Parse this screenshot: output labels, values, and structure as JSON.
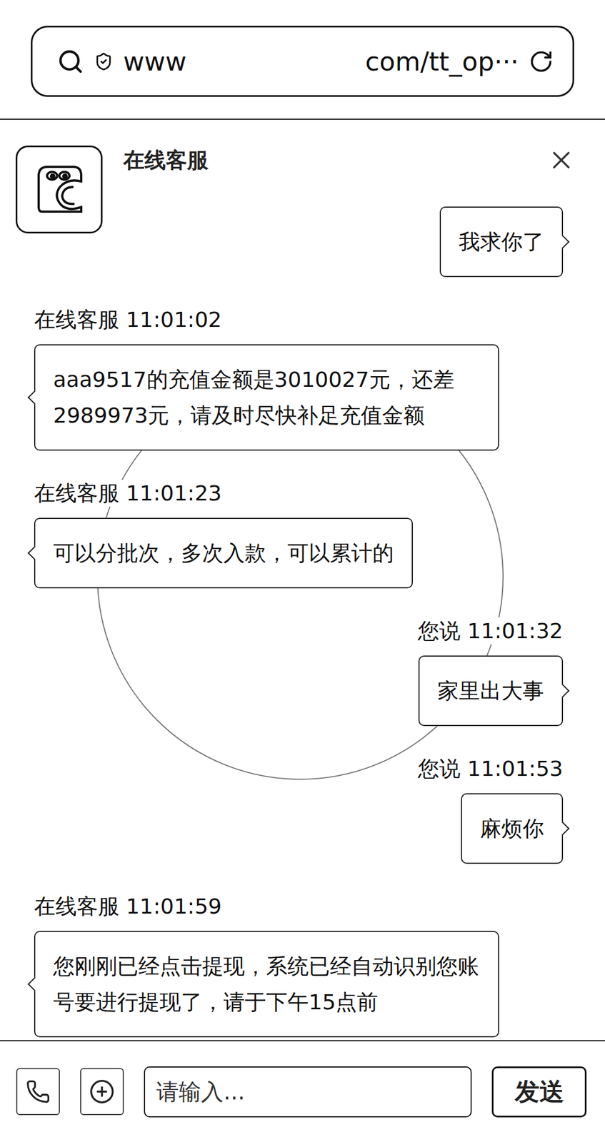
{
  "address_bar": {
    "prefix": "www",
    "suffix": "com/tt_op···"
  },
  "chat": {
    "title": "在线客服"
  },
  "messages": [
    {
      "kind": "user",
      "sender": "",
      "time": "",
      "text": "我求你了"
    },
    {
      "kind": "agent",
      "sender": "在线客服",
      "time": "11:01:02",
      "text": "aaa9517的充值金额是3010027元，还差2989973元，请及时尽快补足充值金额"
    },
    {
      "kind": "agent",
      "sender": "在线客服",
      "time": "11:01:23",
      "text": "可以分批次，多次入款，可以累计的"
    },
    {
      "kind": "user",
      "sender": "您说",
      "time": "11:01:32",
      "text": "家里出大事"
    },
    {
      "kind": "user",
      "sender": "您说",
      "time": "11:01:53",
      "text": "麻烦你"
    },
    {
      "kind": "agent",
      "sender": "在线客服",
      "time": "11:01:59",
      "text": "您刚刚已经点击提现，系统已经自动识别您账号要进行提现了，请于下午15点前"
    }
  ],
  "input": {
    "placeholder": "请输入..."
  },
  "send_button": "发送"
}
